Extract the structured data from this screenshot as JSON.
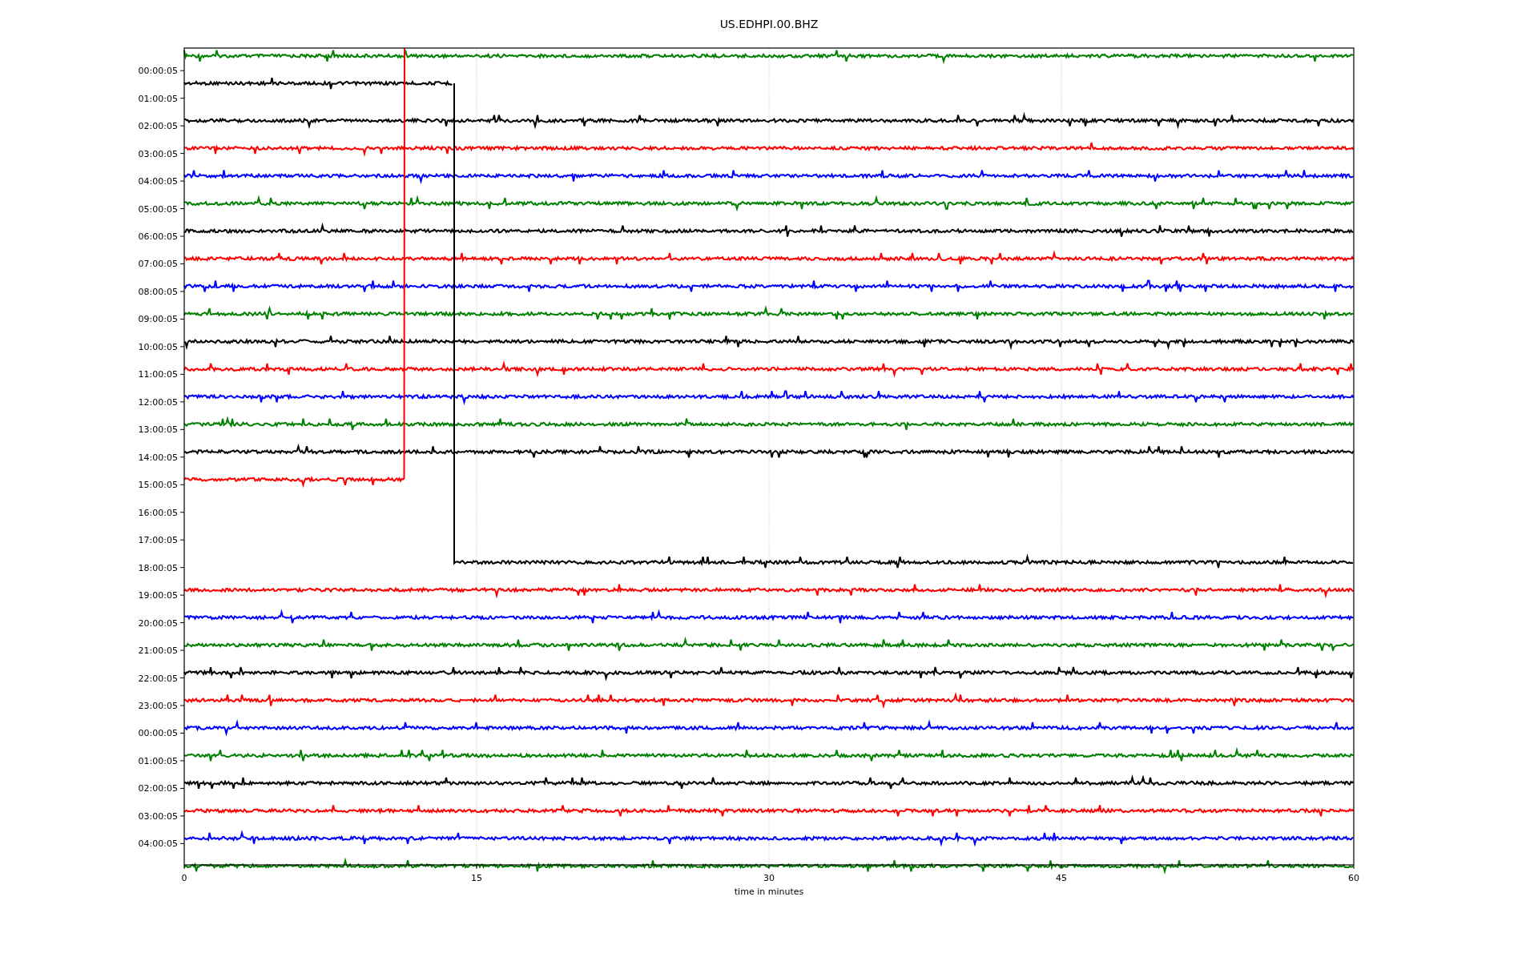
{
  "title": "US.EDHPI.00.BHZ",
  "y_tick_labels": [
    "00:00:05",
    "01:00:05",
    "02:00:05",
    "03:00:05",
    "04:00:05",
    "05:00:05",
    "06:00:05",
    "07:00:05",
    "08:00:05",
    "09:00:05",
    "10:00:05",
    "11:00:05",
    "12:00:05",
    "13:00:05",
    "14:00:05",
    "15:00:05",
    "16:00:05",
    "17:00:05",
    "18:00:05",
    "19:00:05",
    "20:00:05",
    "21:00:05",
    "22:00:05",
    "23:00:05",
    "00:00:05",
    "01:00:05",
    "02:00:05",
    "03:00:05",
    "04:00:05"
  ],
  "x_tick_labels": [
    "0",
    "15",
    "30",
    "45",
    "60"
  ],
  "xlabel": "time in minutes",
  "traces": [
    {
      "kind": "full",
      "color": "#008000"
    },
    {
      "kind": "ends-early",
      "color": "#000000"
    },
    {
      "kind": "full",
      "color": "#000000"
    },
    {
      "kind": "full",
      "color": "#ff0000"
    },
    {
      "kind": "full",
      "color": "#0000ff"
    },
    {
      "kind": "full",
      "color": "#008000"
    },
    {
      "kind": "full",
      "color": "#000000"
    },
    {
      "kind": "full",
      "color": "#ff0000"
    },
    {
      "kind": "full",
      "color": "#0000ff"
    },
    {
      "kind": "full",
      "color": "#008000"
    },
    {
      "kind": "full",
      "color": "#000000"
    },
    {
      "kind": "full",
      "color": "#ff0000"
    },
    {
      "kind": "full",
      "color": "#0000ff"
    },
    {
      "kind": "full",
      "color": "#008000"
    },
    {
      "kind": "full",
      "color": "#000000"
    },
    {
      "kind": "ends-early",
      "color": "#ff0000"
    },
    {
      "kind": "empty"
    },
    {
      "kind": "empty"
    },
    {
      "kind": "starts-late",
      "color": "#000000"
    },
    {
      "kind": "full",
      "color": "#ff0000"
    },
    {
      "kind": "full",
      "color": "#0000ff"
    },
    {
      "kind": "full",
      "color": "#008000"
    },
    {
      "kind": "full",
      "color": "#000000"
    },
    {
      "kind": "full",
      "color": "#ff0000"
    },
    {
      "kind": "full",
      "color": "#0000ff"
    },
    {
      "kind": "full",
      "color": "#008000"
    },
    {
      "kind": "full",
      "color": "#000000"
    },
    {
      "kind": "full",
      "color": "#ff0000"
    },
    {
      "kind": "full",
      "color": "#0000ff"
    },
    {
      "kind": "full",
      "color": "#008000"
    }
  ]
}
